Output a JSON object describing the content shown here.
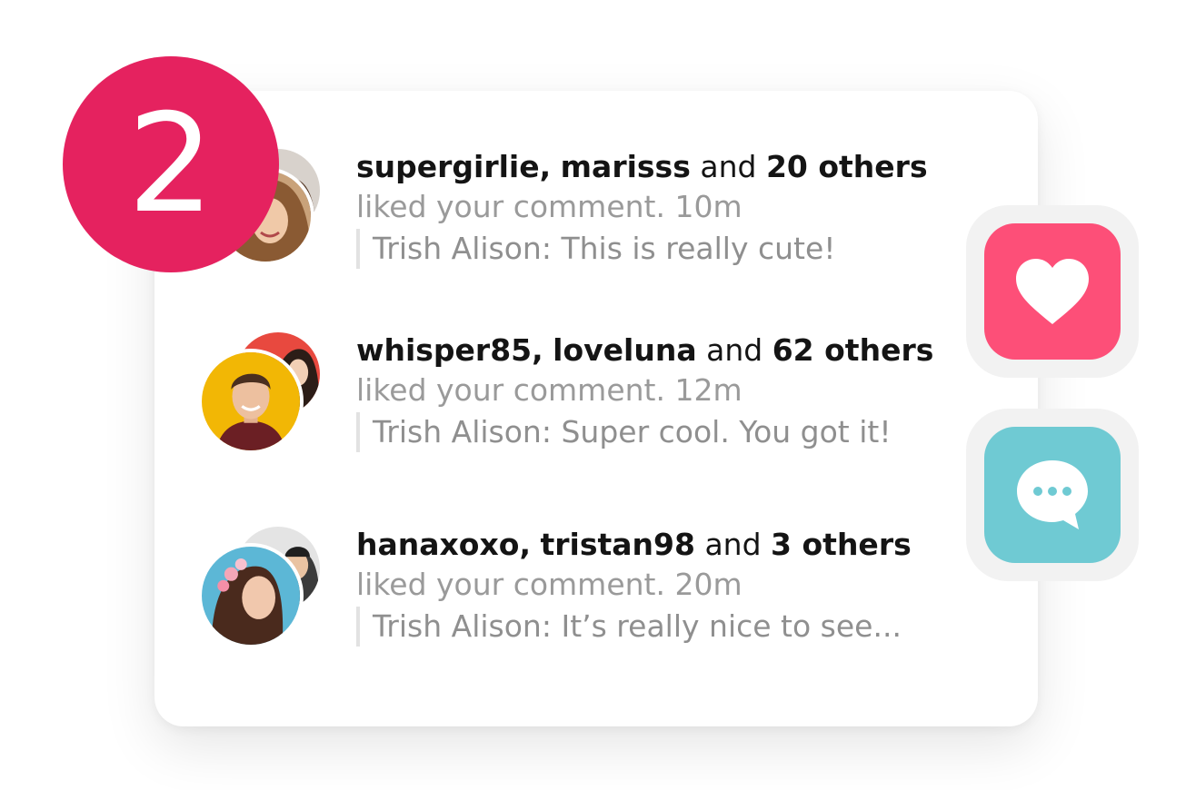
{
  "badge": {
    "count": "2"
  },
  "notifications": [
    {
      "user1": "supergirlie,",
      "user2": "marisss",
      "and": "and",
      "others": "20 others",
      "action": "liked your comment. 10m",
      "comment": "Trish Alison: This is really cute!"
    },
    {
      "user1": "whisper85,",
      "user2": "loveluna",
      "and": "and",
      "others": "62 others",
      "action": "liked your comment. 12m",
      "comment": "Trish Alison: Super cool. You got it!"
    },
    {
      "user1": "hanaxoxo,",
      "user2": "tristan98",
      "and": "and",
      "others": "3 others",
      "action": "liked your comment. 20m",
      "comment": "Trish Alison: It’s really nice to see..."
    }
  ],
  "actions": {
    "like_icon": "heart-icon",
    "comment_icon": "chat-bubble-icon",
    "like_color": "#fd4f78",
    "comment_color": "#6fcad3"
  },
  "colors": {
    "badge": "#e5225f"
  }
}
